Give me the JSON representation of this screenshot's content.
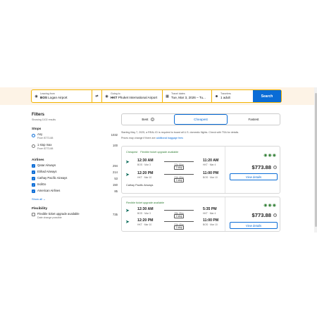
{
  "search": {
    "from_label": "Leaving from",
    "from_code": "BOS",
    "from_name": "Logan Airport",
    "swap_icon": "swap-icon",
    "to_label": "Going to",
    "to_code": "HKT",
    "to_name": "Phuket International Airport",
    "date_label": "Travel dates",
    "date_value": "Tue, Mar 3, 2026 – Tu...",
    "trav_label": "Travelers",
    "trav_value": "1 adult",
    "button": "Search",
    "accent": "#f2b300",
    "button_color": "#0a6cd6"
  },
  "filters": {
    "title": "Filters",
    "subtitle": "Showing 1102 results",
    "stops_heading": "Stops",
    "stops": [
      {
        "label": "Any",
        "sub": "From $773.88",
        "count": "1032",
        "selected": true
      },
      {
        "label": "1 stop max",
        "sub": "From $773.88",
        "count": "100",
        "selected": false
      }
    ],
    "airlines_heading": "Airlines",
    "airlines": [
      {
        "label": "Qatar Airways",
        "count": "294"
      },
      {
        "label": "Etihad Airways",
        "count": "214"
      },
      {
        "label": "Cathay Pacific Airways",
        "count": "53"
      },
      {
        "label": "IndiGo",
        "count": "150"
      },
      {
        "label": "American Airlines",
        "count": "85"
      }
    ],
    "show_all": "Show all",
    "flex_heading": "Flexibility",
    "flex_label": "Flexible ticket upgrade available",
    "flex_sub": "Date change possible",
    "flex_count": "735"
  },
  "tabs": {
    "best": "Best",
    "cheapest": "Cheapest",
    "fastest": "Fastest"
  },
  "notice": {
    "line1": "Starting May 7, 2025, a REAL ID is required to board all U.S. domestic flights. Check with TSA for details.",
    "line2": "Prices may change if there are",
    "link": "additional baggage fees"
  },
  "results": [
    {
      "tag_cheapest": "Cheapest",
      "tag_flex": "Flexible ticket upgrade available",
      "legs": [
        {
          "dep_time": "12:30 AM",
          "dep_ap": "BOS · Mar 3",
          "stops": "1 stop",
          "duration": "22h 50m",
          "arr_time": "11:20 AM",
          "arr_ap": "HKT · Mar 4"
        },
        {
          "dep_time": "12:20 PM",
          "dep_ap": "HKT · Mar 10",
          "stops": "1 stop",
          "duration": "21h 40m",
          "arr_time": "11:00 PM",
          "arr_ap": "BOS · Mar 10"
        }
      ],
      "airline": "Cathay Pacific Airways",
      "price": "$773.88",
      "details": "View details"
    },
    {
      "tag_flex": "Flexible ticket upgrade available",
      "legs": [
        {
          "dep_time": "12:30 AM",
          "dep_ap": "BOS · Mar 3",
          "stops": "1 stop",
          "duration": "29h 05m",
          "arr_time": "5:35 PM",
          "arr_ap": "HKT · Mar 4"
        },
        {
          "dep_time": "12:20 PM",
          "dep_ap": "HKT · Mar 10",
          "stops": "1 stop",
          "duration": "21h 40m",
          "arr_time": "11:00 PM",
          "arr_ap": "BOS · Mar 10"
        }
      ],
      "price": "$773.88",
      "details": "View details"
    }
  ]
}
